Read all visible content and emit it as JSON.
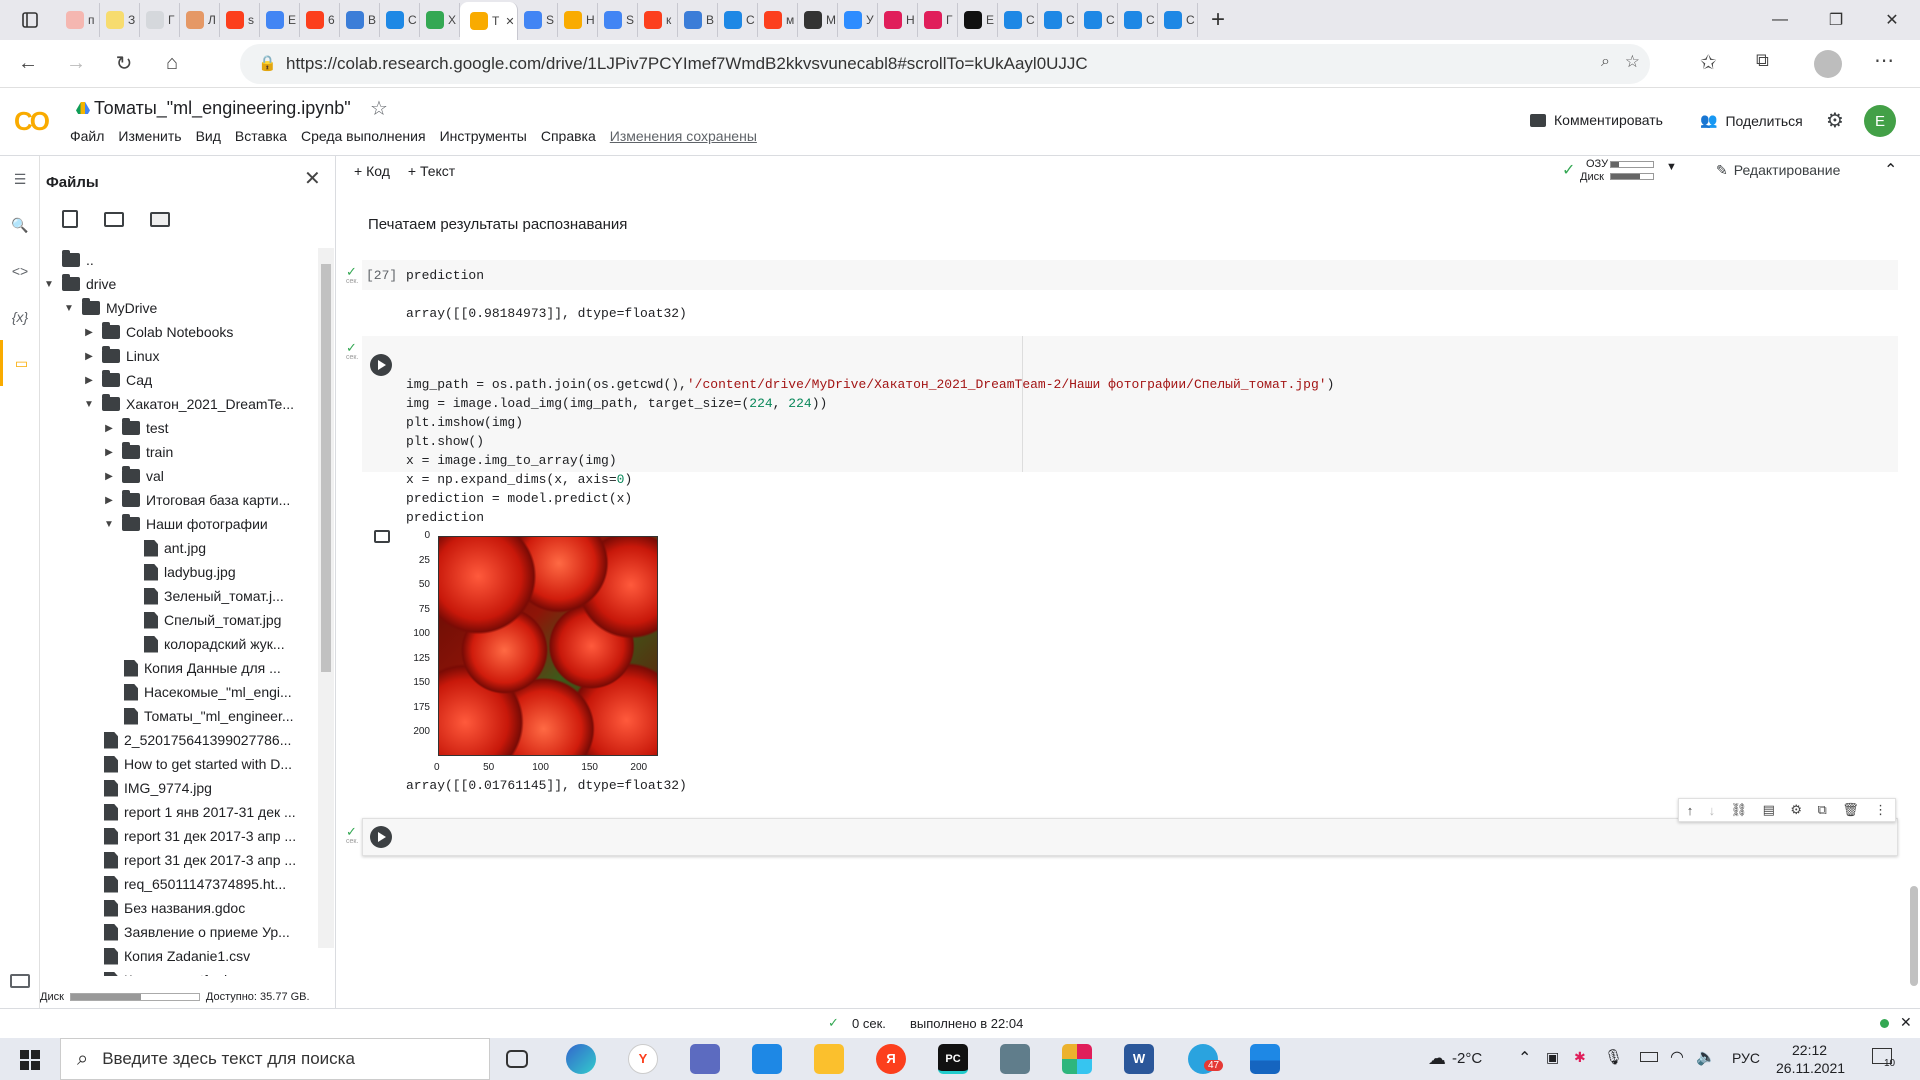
{
  "browser": {
    "tabs": [
      {
        "label": "п",
        "color": "#f5b7b1"
      },
      {
        "label": "З",
        "color": "#f7dc6f"
      },
      {
        "label": "Г",
        "color": "#d5d8dc"
      },
      {
        "label": "Л",
        "color": "#e59866"
      },
      {
        "label": "s",
        "color": "#fc3f1d"
      },
      {
        "label": "Е",
        "color": "#4285f4"
      },
      {
        "label": "6",
        "color": "#fc3f1d"
      },
      {
        "label": "В",
        "color": "#3b7dd8"
      },
      {
        "label": "С",
        "color": "#1e88e5"
      },
      {
        "label": "X",
        "color": "#34a853"
      },
      {
        "label": "Т",
        "color": "#f9ab00"
      },
      {
        "label": "S",
        "color": "#4285f4"
      },
      {
        "label": "Н",
        "color": "#f9ab00"
      },
      {
        "label": "S",
        "color": "#4285f4"
      },
      {
        "label": "к",
        "color": "#fc3f1d"
      },
      {
        "label": "В",
        "color": "#3b7dd8"
      },
      {
        "label": "С",
        "color": "#1e88e5"
      },
      {
        "label": "м",
        "color": "#fc3f1d"
      },
      {
        "label": "М",
        "color": "#333333"
      },
      {
        "label": "У",
        "color": "#2d8cff"
      },
      {
        "label": "Н",
        "color": "#e01e5a"
      },
      {
        "label": "Г",
        "color": "#e01e5a"
      },
      {
        "label": "Е",
        "color": "#111111"
      },
      {
        "label": "С",
        "color": "#1e88e5"
      },
      {
        "label": "С",
        "color": "#1e88e5"
      },
      {
        "label": "С",
        "color": "#1e88e5"
      },
      {
        "label": "С",
        "color": "#1e88e5"
      },
      {
        "label": "С",
        "color": "#1e88e5"
      }
    ],
    "active_tab_index": 10,
    "url": "https://colab.research.google.com/drive/1LJPiv7PCYImef7WmdB2kkvsvunecabl8#scrollTo=kUkAayl0UJJC"
  },
  "colab": {
    "logo": "CO",
    "notebook_title": "Томаты_\"ml_engineering.ipynb\"",
    "menu": [
      "Файл",
      "Изменить",
      "Вид",
      "Вставка",
      "Среда выполнения",
      "Инструменты",
      "Справка"
    ],
    "saved_status": "Изменения сохранены",
    "comment_label": "Комментировать",
    "share_label": "Поделиться",
    "avatar_letter": "E",
    "add_code": "+ Код",
    "add_text": "+ Текст",
    "ram_label": "ОЗУ",
    "disk_label": "Диск",
    "editing_label": "Редактирование"
  },
  "files_panel": {
    "title": "Файлы",
    "tree": [
      {
        "label": "..",
        "type": "up",
        "indent": 0
      },
      {
        "label": "drive",
        "type": "folder",
        "indent": 0,
        "caret": "down"
      },
      {
        "label": "MyDrive",
        "type": "folder",
        "indent": 1,
        "caret": "down"
      },
      {
        "label": "Colab Notebooks",
        "type": "folder",
        "indent": 2,
        "caret": "right"
      },
      {
        "label": "Linux",
        "type": "folder",
        "indent": 2,
        "caret": "right"
      },
      {
        "label": "Сад",
        "type": "folder",
        "indent": 2,
        "caret": "right"
      },
      {
        "label": "Хакатон_2021_DreamTe...",
        "type": "folder",
        "indent": 2,
        "caret": "down"
      },
      {
        "label": "test",
        "type": "folder",
        "indent": 3,
        "caret": "right"
      },
      {
        "label": "train",
        "type": "folder",
        "indent": 3,
        "caret": "right"
      },
      {
        "label": "val",
        "type": "folder",
        "indent": 3,
        "caret": "right"
      },
      {
        "label": "Итоговая база карти...",
        "type": "folder",
        "indent": 3,
        "caret": "right"
      },
      {
        "label": "Наши фотографии",
        "type": "folder",
        "indent": 3,
        "caret": "down"
      },
      {
        "label": "ant.jpg",
        "type": "file",
        "indent": 4
      },
      {
        "label": "ladybug.jpg",
        "type": "file",
        "indent": 4
      },
      {
        "label": "Зеленый_томат.j...",
        "type": "file",
        "indent": 4
      },
      {
        "label": "Спелый_томат.jpg",
        "type": "file",
        "indent": 4
      },
      {
        "label": "колорадский жук...",
        "type": "file",
        "indent": 4
      },
      {
        "label": "Копия Данные для ...",
        "type": "file",
        "indent": 3
      },
      {
        "label": "Насекомые_\"ml_engi...",
        "type": "file",
        "indent": 3
      },
      {
        "label": "Томаты_\"ml_engineer...",
        "type": "file",
        "indent": 3
      },
      {
        "label": "2_520175641399027786...",
        "type": "file",
        "indent": 2
      },
      {
        "label": "How to get started with D...",
        "type": "file",
        "indent": 2
      },
      {
        "label": "IMG_9774.jpg",
        "type": "file",
        "indent": 2
      },
      {
        "label": "report 1 янв 2017-31 дек ...",
        "type": "file",
        "indent": 2
      },
      {
        "label": "report 31 дек 2017-3 апр ...",
        "type": "file",
        "indent": 2
      },
      {
        "label": "report 31 дек 2017-3 апр ...",
        "type": "file",
        "indent": 2
      },
      {
        "label": "req_65011147374895.ht...",
        "type": "file",
        "indent": 2
      },
      {
        "label": "Без названия.gdoc",
        "type": "file",
        "indent": 2
      },
      {
        "label": "Заявление о приеме Ур...",
        "type": "file",
        "indent": 2
      },
      {
        "label": "Копия Zadanie1.csv",
        "type": "file",
        "indent": 2
      },
      {
        "label": "Кравченко.rtf.gdoc",
        "type": "file",
        "indent": 2
      }
    ],
    "disk_label": "Диск",
    "disk_free": "Доступно: 35.77 GB."
  },
  "cells": {
    "text_cell": "Печатаем результаты распознавания",
    "cell1_exec": "[27]",
    "cell1_code": "prediction",
    "cell1_output": "array([[0.98184973]], dtype=float32)",
    "cell2_code": {
      "l1_a": "img_path = os.path.join(os.getcwd(),",
      "l1_str": "'/content/drive/MyDrive/Хакатон_2021_DreamTeam-2/Наши фотографии/Спелый_томат.jpg'",
      "l1_b": ")",
      "l2_a": "img = image.load_img(img_path, target_size=(",
      "l2_n1": "224",
      "l2_sep": ", ",
      "l2_n2": "224",
      "l2_b": "))",
      "l3": "plt.imshow(img)",
      "l4": "plt.show()",
      "l5": "x = image.img_to_array(img)",
      "l6_a": "x = np.expand_dims(x, axis=",
      "l6_n": "0",
      "l6_b": ")",
      "l7": "prediction = model.predict(x)",
      "l8": "prediction"
    },
    "image_plot": {
      "y_ticks": [
        "0",
        "25",
        "50",
        "75",
        "100",
        "125",
        "150",
        "175",
        "200"
      ],
      "x_ticks": [
        "0",
        "50",
        "100",
        "150",
        "200"
      ]
    },
    "cell2_output": "array([[0.01761145]], dtype=float32)",
    "exec_time_label": "сек."
  },
  "status": {
    "time": "0 сек.",
    "completed": "выполнено в 22:04"
  },
  "taskbar": {
    "search_placeholder": "Введите здесь текст для поиска",
    "temperature": "-2°C",
    "lang": "РУС",
    "time": "22:12",
    "date": "26.11.2021",
    "notif_count": "10",
    "telegram_badge": "47"
  }
}
